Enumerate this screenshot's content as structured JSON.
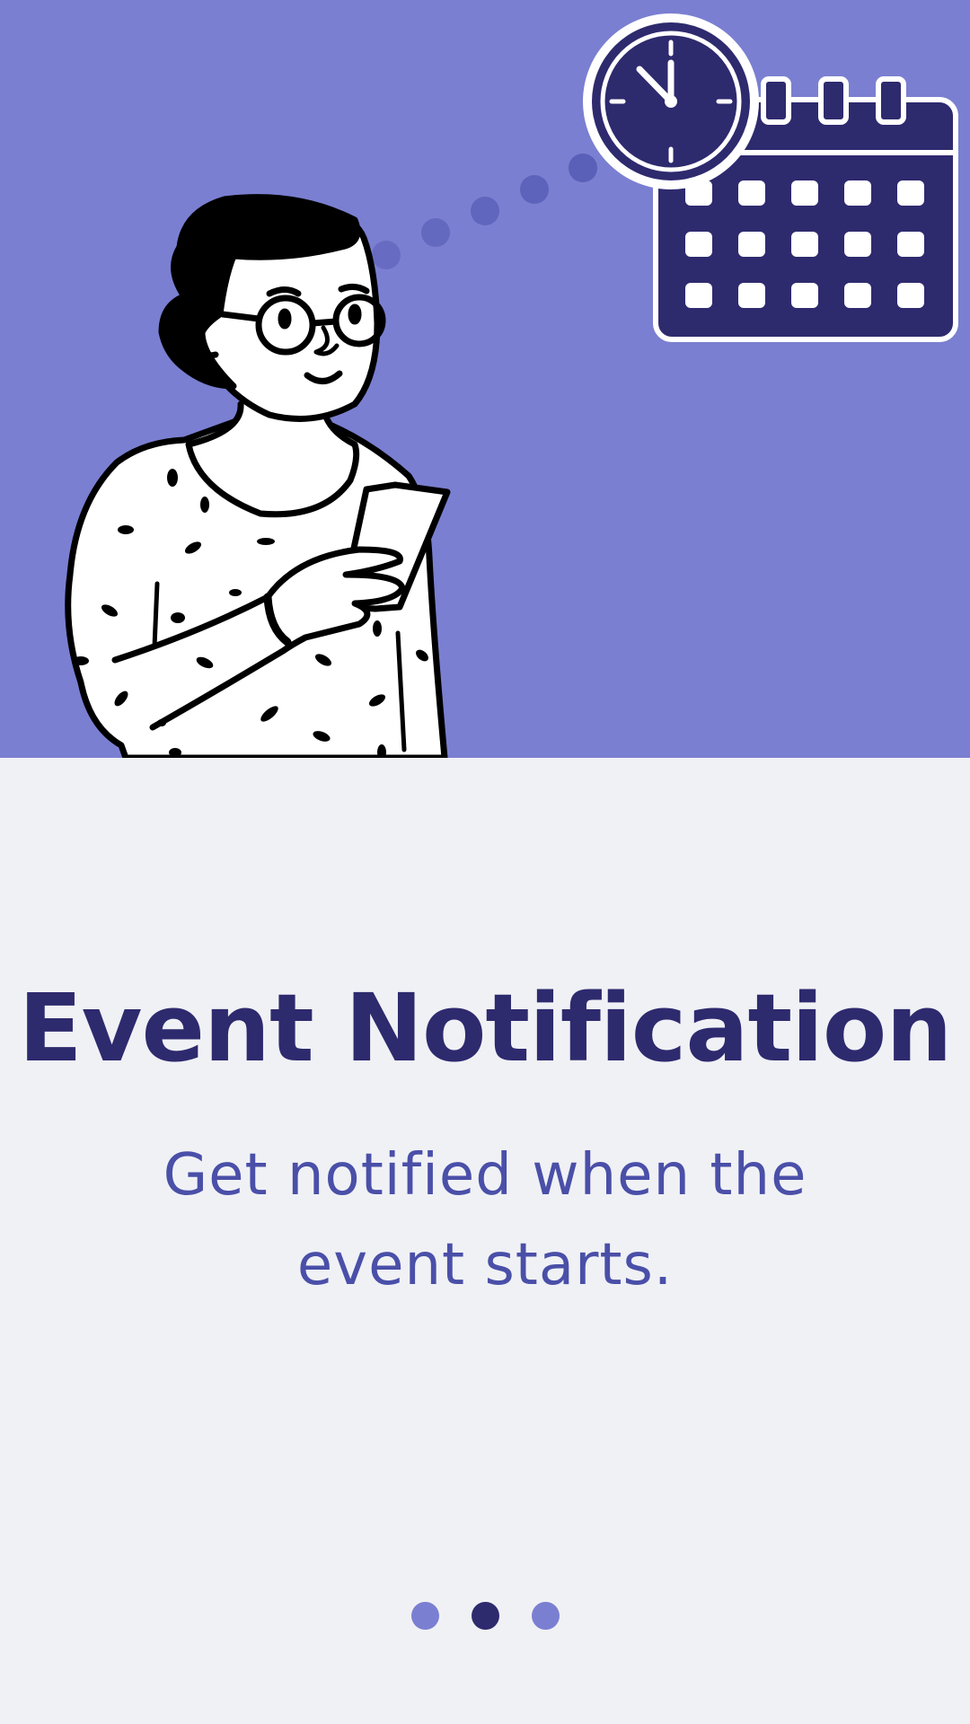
{
  "onboarding": {
    "title": "Event Notification",
    "subtitle": "Get notified when the event starts.",
    "page_indicator": {
      "total": 3,
      "active_index": 1
    }
  },
  "colors": {
    "hero_background": "#7a7fd1",
    "page_background": "#f0f1f5",
    "title": "#2e2a6e",
    "subtitle": "#4a4fa8",
    "dot_inactive": "#7a7fd1",
    "dot_active": "#2e2a6e"
  },
  "illustration": {
    "icons": [
      "clock-icon",
      "calendar-icon",
      "person-with-phone-illustration"
    ]
  }
}
